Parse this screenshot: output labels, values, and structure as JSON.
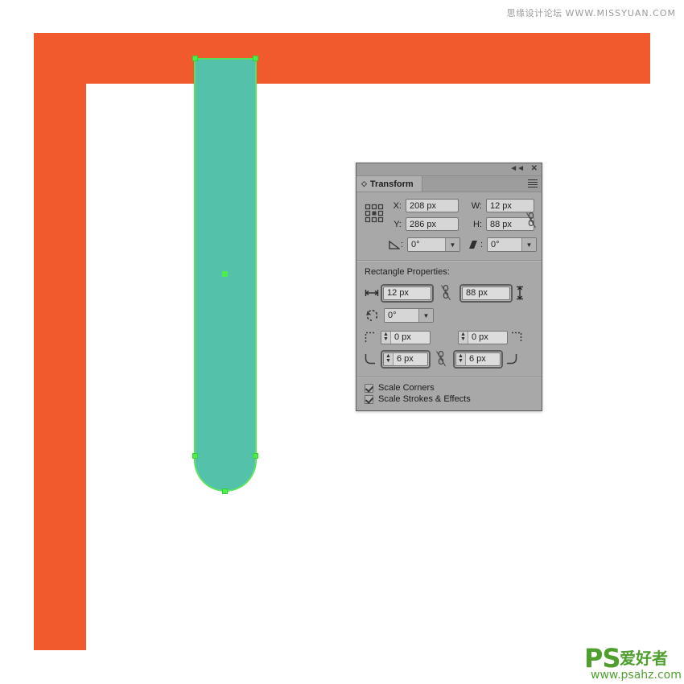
{
  "watermarks": {
    "top_cn": "思缘设计论坛",
    "top_url": "WWW.MISSYUAN.COM",
    "bottom_ps": "PS",
    "bottom_cn": "爱好者",
    "bottom_url": "www.psahz.com"
  },
  "artboard": {
    "frame_color": "#f15a2d",
    "canvas_color": "#ffffff",
    "shape": {
      "name": "rounded-bottom-bar",
      "fill_color": "#54c2aa",
      "selection_color": "#4cee4c"
    }
  },
  "panel": {
    "title": "Transform",
    "titlebar": {
      "collapse_label": "◄◄",
      "close_label": "✕"
    },
    "menu_label": "panel-menu",
    "transform": {
      "x_label": "X:",
      "x_value": "208 px",
      "y_label": "Y:",
      "y_value": "286 px",
      "w_label": "W:",
      "w_value": "12 px",
      "h_label": "H:",
      "h_value": "88 px",
      "rotate_label": ":",
      "rotate_value": "0°",
      "shear_label": ":",
      "shear_value": "0°",
      "reference_point": "center",
      "link_state": "unlinked"
    },
    "rectangle_properties": {
      "heading": "Rectangle Properties:",
      "width_value": "12 px",
      "height_value": "88 px",
      "angle_value": "0°",
      "corner_top_left": "0 px",
      "corner_top_right": "0 px",
      "corner_bottom_left": "6 px",
      "corner_bottom_right": "6 px",
      "link_state": "unlinked"
    },
    "options": [
      {
        "label": "Scale Corners",
        "checked": true
      },
      {
        "label": "Scale Strokes & Effects",
        "checked": true
      }
    ]
  }
}
